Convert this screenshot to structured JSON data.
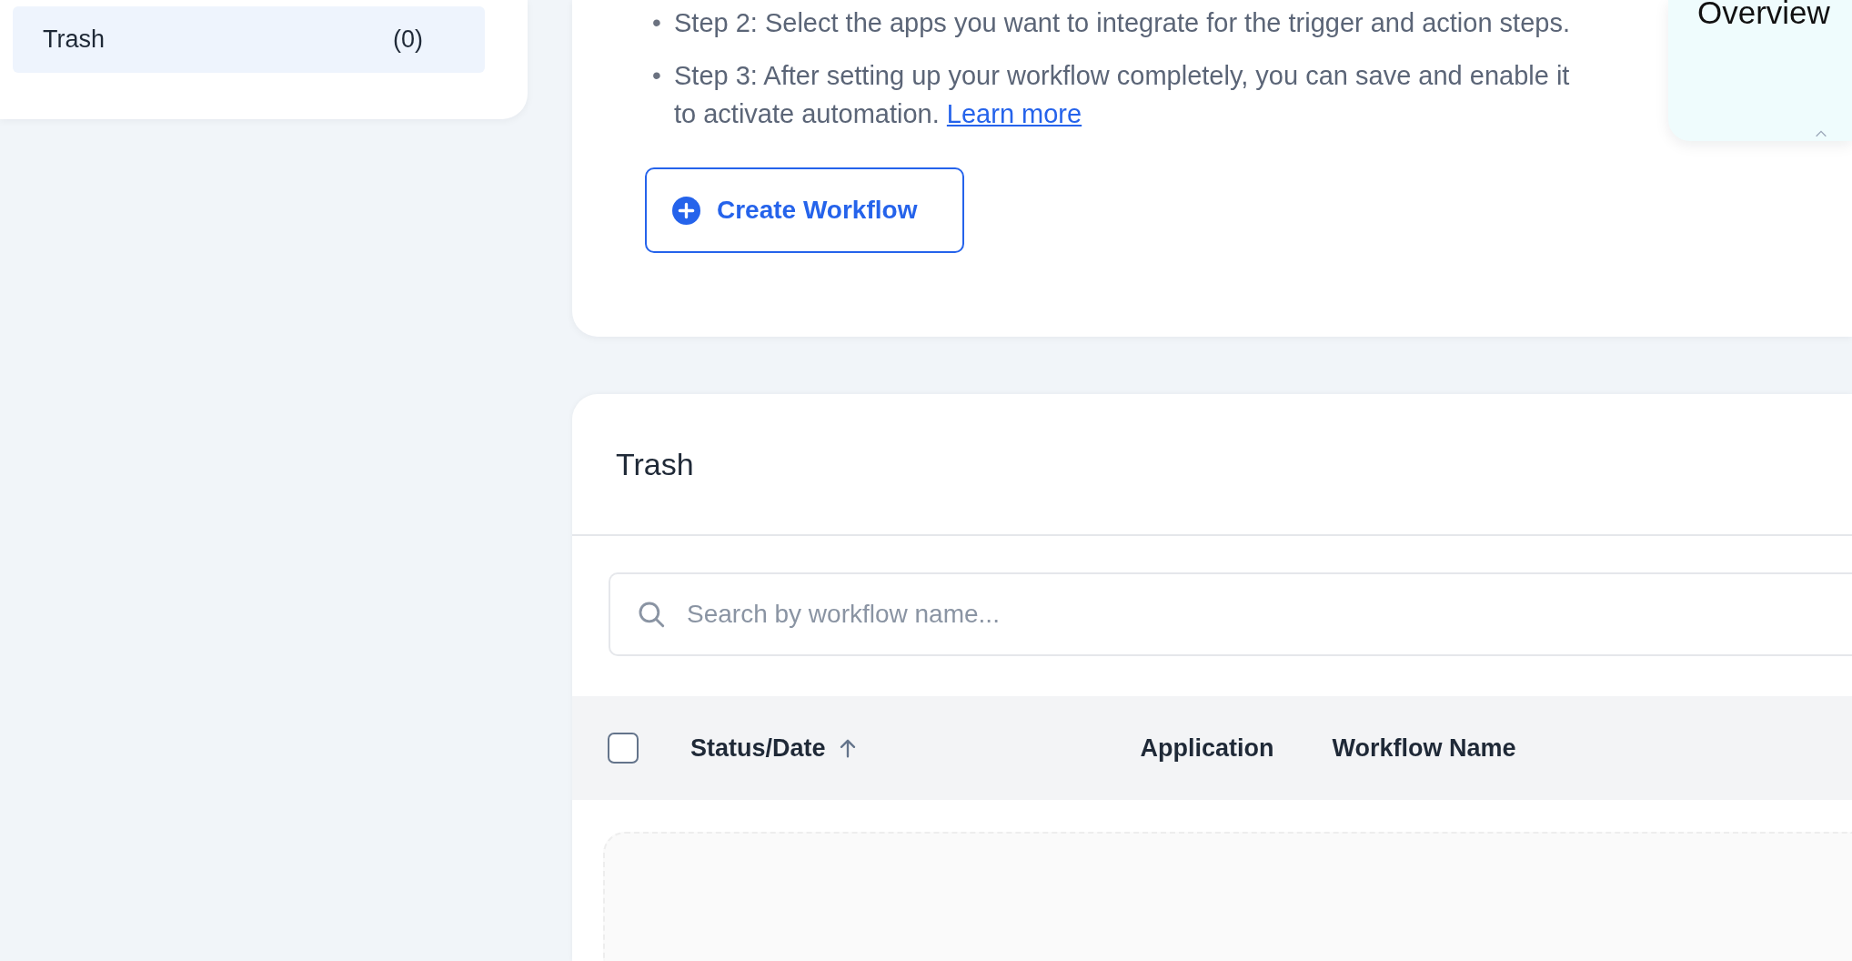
{
  "sidebar": {
    "items": [
      {
        "label": "Trash",
        "count": "(0)",
        "selected": true
      }
    ]
  },
  "intro": {
    "steps": [
      {
        "bullet": "•",
        "text": "Step 2: Select the apps you want to integrate for the trigger and action steps."
      },
      {
        "bullet": "•",
        "text": "Step 3: After setting up your workflow completely, you can save and enable it to activate automation.",
        "link": "Learn more"
      }
    ],
    "create_button": {
      "label": "Create Workflow"
    }
  },
  "overview_card": {
    "title": "Overview"
  },
  "trash_panel": {
    "title": "Trash",
    "search": {
      "placeholder": "Search by workflow name..."
    },
    "table": {
      "select_all": {
        "checked": false
      },
      "columns": [
        {
          "label": "Status/Date",
          "sorted": true
        },
        {
          "label": "Application",
          "sorted": false
        },
        {
          "label": "Workflow Name",
          "sorted": false
        }
      ]
    }
  }
}
